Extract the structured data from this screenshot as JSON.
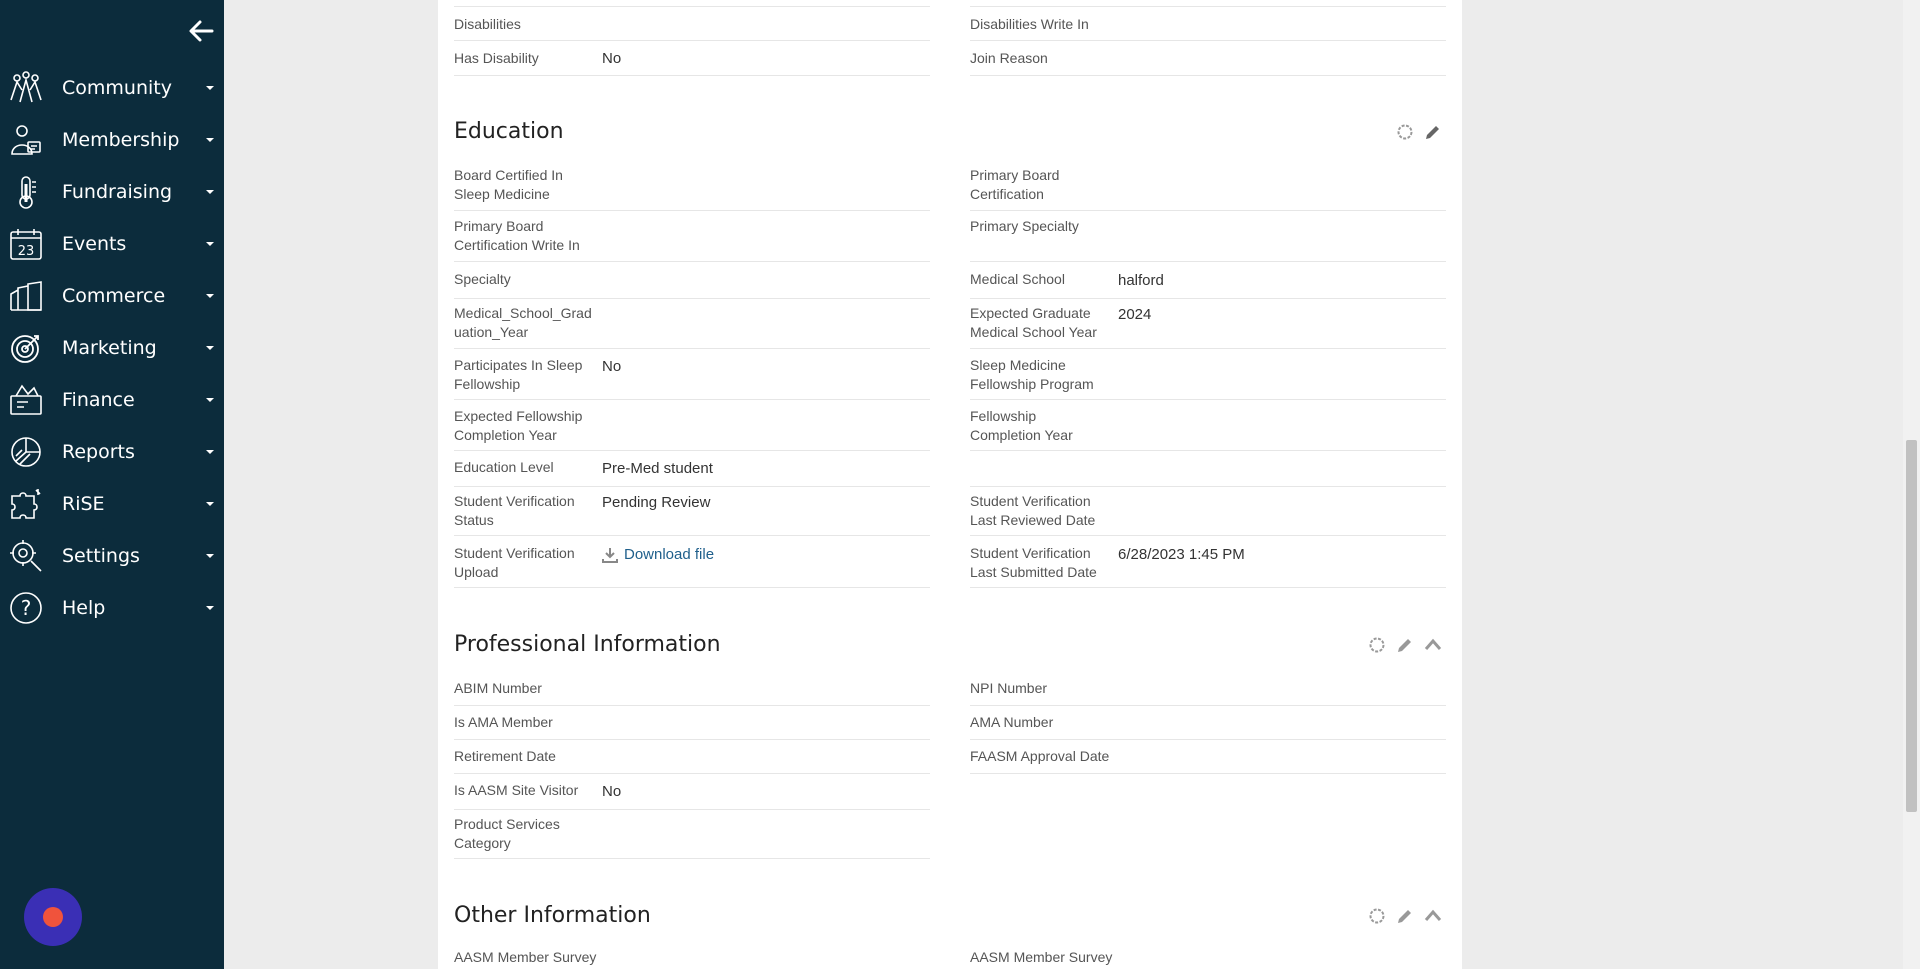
{
  "sidebar": {
    "items": [
      {
        "label": "Community",
        "icon": "community-icon"
      },
      {
        "label": "Membership",
        "icon": "membership-icon"
      },
      {
        "label": "Fundraising",
        "icon": "thermometer-icon"
      },
      {
        "label": "Events",
        "icon": "calendar-icon",
        "calendar_day": "23"
      },
      {
        "label": "Commerce",
        "icon": "commerce-icon"
      },
      {
        "label": "Marketing",
        "icon": "target-icon"
      },
      {
        "label": "Finance",
        "icon": "finance-icon"
      },
      {
        "label": "Reports",
        "icon": "reports-icon"
      },
      {
        "label": "RiSE",
        "icon": "puzzle-icon"
      },
      {
        "label": "Settings",
        "icon": "settings-icon"
      },
      {
        "label": "Help",
        "icon": "help-icon",
        "glyph": "?"
      }
    ]
  },
  "top_fields": {
    "left": [
      {
        "label": "Disabilities",
        "value": ""
      },
      {
        "label": "Has Disability",
        "value": "No"
      }
    ],
    "right": [
      {
        "label": "Disabilities Write In",
        "value": ""
      },
      {
        "label": "Join Reason",
        "value": ""
      }
    ]
  },
  "education": {
    "title": "Education",
    "left": [
      {
        "label": "Board Certified In Sleep Medicine",
        "value": ""
      },
      {
        "label": "Primary Board Certification Write In",
        "value": ""
      },
      {
        "label": "Specialty",
        "value": ""
      },
      {
        "label": "Medical_School_Graduation_Year",
        "value": ""
      },
      {
        "label": "Participates In Sleep Fellowship",
        "value": "No"
      },
      {
        "label": "Expected Fellowship Completion Year",
        "value": ""
      },
      {
        "label": "Education Level",
        "value": "Pre-Med student"
      },
      {
        "label": "Student Verification Status",
        "value": "Pending Review"
      },
      {
        "label": "Student Verification Upload",
        "value": "Download file"
      }
    ],
    "right": [
      {
        "label": "Primary Board Certification",
        "value": ""
      },
      {
        "label": "Primary Specialty",
        "value": ""
      },
      {
        "label": "Medical School",
        "value": "halford"
      },
      {
        "label": "Expected Graduate Medical School Year",
        "value": "2024"
      },
      {
        "label": "Sleep Medicine Fellowship Program",
        "value": ""
      },
      {
        "label": "Fellowship Completion Year",
        "value": ""
      },
      {
        "label": "",
        "value": ""
      },
      {
        "label": "Student Verification Last Reviewed Date",
        "value": ""
      },
      {
        "label": "Student Verification Last Submitted Date",
        "value": "6/28/2023 1:45 PM"
      }
    ]
  },
  "professional": {
    "title": "Professional Information",
    "left": [
      {
        "label": "ABIM Number",
        "value": ""
      },
      {
        "label": "Is AMA Member",
        "value": ""
      },
      {
        "label": "Retirement Date",
        "value": ""
      },
      {
        "label": "Is AASM Site Visitor",
        "value": "No"
      },
      {
        "label": "Product Services Category",
        "value": ""
      }
    ],
    "right": [
      {
        "label": "NPI Number",
        "value": ""
      },
      {
        "label": "AMA Number",
        "value": ""
      },
      {
        "label": "FAASM Approval Date",
        "value": ""
      }
    ]
  },
  "other": {
    "title": "Other Information",
    "left": [
      {
        "label": "AASM Member Survey",
        "value": ""
      }
    ],
    "right": [
      {
        "label": "AASM Member Survey",
        "value": ""
      }
    ]
  },
  "colors": {
    "sidebar_bg": "#0c2c3c",
    "link": "#1f5f8b",
    "chat_bubble": "#3a2fb5",
    "chat_dot": "#f0533c"
  }
}
